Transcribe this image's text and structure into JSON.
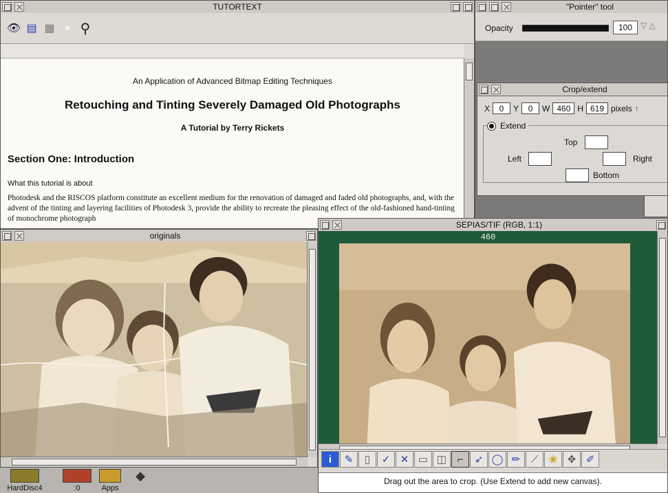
{
  "tutortext": {
    "title": "TUTORTEXT",
    "line1": "An Application of Advanced Bitmap Editing Techniques",
    "line2": "Retouching and Tinting Severely Damaged Old Photographs",
    "line3": "A Tutorial by Terry Rickets",
    "section": "Section One: Introduction",
    "subheading": "What this tutorial is about",
    "body": "Photodesk and the RISCOS platform constitute an excellent medium for the renovation of damaged and faded old photographs, and, with the advent of the tinting and layering facilities of Photodesk 3, provide the ability to recreate the pleasing effect of the old-fashioned hand-tinting of monochrome photograph"
  },
  "pointer_tool": {
    "title": "\"Pointer\" tool",
    "opacity_label": "Opacity",
    "opacity_value": "100",
    "opacity_fraction": 1.0
  },
  "crop_extend": {
    "title": "Crop/extend",
    "x_label": "X",
    "x_value": "0",
    "y_label": "Y",
    "y_value": "0",
    "w_label": "W",
    "w_value": "460",
    "h_label": "H",
    "h_value": "619",
    "units": "pixels",
    "extend_label": "Extend",
    "top_label": "Top",
    "left_label": "Left",
    "right_label": "Right",
    "bottom_label": "Bottom"
  },
  "originals": {
    "title": "originals"
  },
  "sepias": {
    "title": "SEPIAS/TIF (RGB, 1:1)",
    "ruler_value": "460",
    "status": "Drag out the area to crop. (Use Extend to add new canvas)."
  },
  "iconbar": {
    "items": [
      {
        "label": "HardDisc4"
      },
      {
        "label": ":0"
      },
      {
        "label": "Apps"
      }
    ]
  },
  "colors": {
    "sepia_frame": "#1f5a3a",
    "tool_accent": "#2a3ea8"
  }
}
